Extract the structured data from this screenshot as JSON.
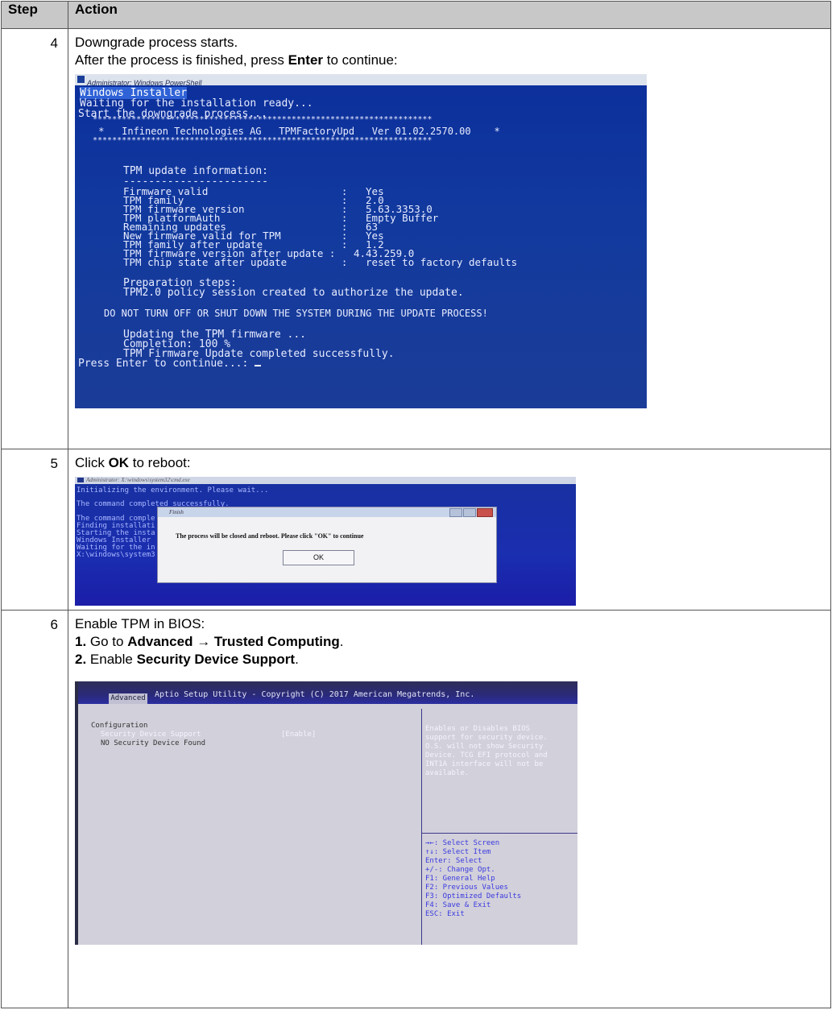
{
  "table": {
    "header": {
      "step": "Step",
      "action": "Action"
    },
    "rows": [
      {
        "step": "4",
        "line1": "Downgrade process starts.",
        "line2_pre": "After the process is finished, press ",
        "line2_bold": "Enter",
        "line2_post": " to continue:"
      },
      {
        "step": "5",
        "pre": "Click ",
        "bold": "OK",
        "post": " to reboot:"
      },
      {
        "step": "6",
        "intro": "Enable TPM in BIOS:",
        "item1_num": "1.",
        "item1_pre": " Go to ",
        "item1_bold": "Advanced → Trusted Computing",
        "item1_post": ".",
        "item2_num": "2.",
        "item2_pre": " Enable ",
        "item2_bold": "Security Device Support",
        "item2_post": "."
      }
    ]
  },
  "shot1": {
    "titlebar": "Administrator: Windows PowerShell",
    "lines": {
      "l1": "Windows Installer",
      "l2": "Waiting for the installation ready...",
      "l3": "Start the downgrade process...",
      "stars1": "**********************************************************************",
      "banner": " *   Infineon Technologies AG   TPMFactoryUpd   Ver 01.02.2570.00    *",
      "stars2": "**********************************************************************",
      "info": "TPM update information:",
      "dash": "-----------------------",
      "r1": "Firmware valid                      :   Yes",
      "r2": "TPM family                          :   2.0",
      "r3": "TPM firmware version                :   5.63.3353.0",
      "r4": "TPM platformAuth                    :   Empty Buffer",
      "r5": "Remaining updates                   :   63",
      "r6": "New firmware valid for TPM          :   Yes",
      "r7": "TPM family after update             :   1.2",
      "r8": "TPM firmware version after update :   4.43.259.0",
      "r9": "TPM chip state after update         :   reset to factory defaults",
      "prep": "Preparation steps:",
      "prep2": "TPM2.0 policy session created to authorize the update.",
      "warn": "DO NOT TURN OFF OR SHUT DOWN THE SYSTEM DURING THE UPDATE PROCESS!",
      "u1": "Updating the TPM firmware ...",
      "u2": "Completion: 100 %",
      "u3": "TPM Firmware Update completed successfully.",
      "press": "Press Enter to continue...: "
    }
  },
  "shot2": {
    "titlebar": "Administrator: X:\\windows\\system32\\cmd.exe",
    "bg_lines": {
      "b1": "Initializing the environment. Please wait...",
      "b2": "The command completed successfully.",
      "b3": "The command comple",
      "b4": "Finding installati",
      "b5": "Starting the insta",
      "b6": "Windows Installer",
      "b7": "Waiting for the in",
      "b8": "X:\\windows\\system3"
    },
    "dialog_title": "Finish",
    "message": "The process will be closed and reboot. Please click \"OK\" to continue",
    "ok_label": "OK"
  },
  "shot3": {
    "title": "Aptio Setup Utility - Copyright (C) 2017 American Megatrends, Inc.",
    "tab": "Advanced",
    "config": "Configuration",
    "item1": "Security Device Support",
    "item1_value": "[Enable]",
    "item2": "NO Security Device Found",
    "help": {
      "h1": "Enables or Disables BIOS",
      "h2": "support for security device.",
      "h3": "O.S. will not show Security",
      "h4": "Device. TCG EFI protocol and",
      "h5": "INT1A interface will not be",
      "h6": "available."
    },
    "keys": {
      "k1": "→←: Select Screen",
      "k2": "↑↓: Select Item",
      "k3": "Enter: Select",
      "k4": "+/-: Change Opt.",
      "k5": "F1: General Help",
      "k6": "F2: Previous Values",
      "k7": "F3: Optimized Defaults",
      "k8": "F4: Save & Exit",
      "k9": "ESC: Exit"
    }
  }
}
